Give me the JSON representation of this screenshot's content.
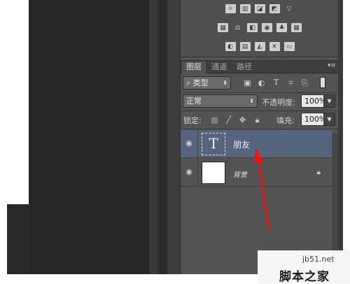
{
  "layers_panel": {
    "tabs": [
      "图层",
      "通道",
      "路径"
    ],
    "filter_kind": "类型",
    "blend_mode": "正常",
    "opacity_label": "不透明度:",
    "opacity_value": "100%",
    "lock_label": "锁定:",
    "fill_label": "填充:",
    "fill_value": "100%",
    "layers": [
      {
        "name": "朋友",
        "type": "text",
        "thumb_glyph": "T",
        "selected": true
      },
      {
        "name": "背景",
        "type": "background",
        "locked": true,
        "selected": false
      }
    ]
  },
  "watermark": {
    "site": "jb51.net",
    "name": "脚本之家"
  },
  "icons": {
    "eye": "eye-icon",
    "lock": "lock-icon",
    "search": "search-icon",
    "menu": "panel-menu-icon"
  },
  "colors": {
    "panel_bg": "#535353",
    "selected_layer": "#56657d",
    "arrow": "#e01818"
  }
}
